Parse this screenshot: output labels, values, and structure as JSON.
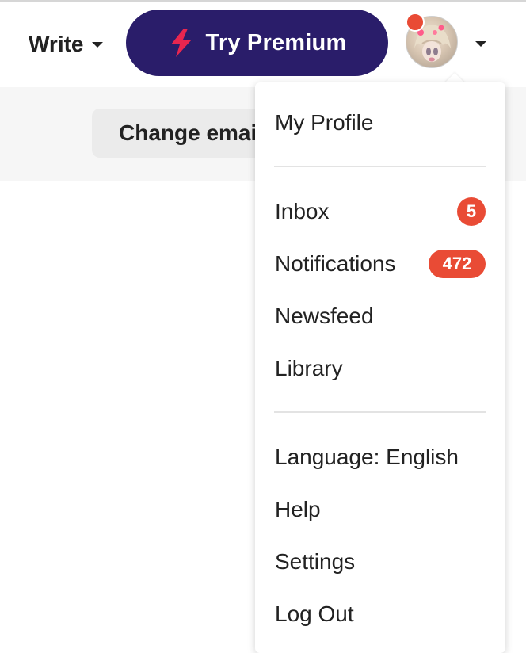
{
  "header": {
    "write_label": "Write",
    "premium_label": "Try Premium",
    "premium_color": "#2a1d6a",
    "bolt_color": "#e8264f",
    "notification_dot_color": "#e94b35"
  },
  "subbar": {
    "change_email_label": "Change email"
  },
  "dropdown": {
    "profile": "My Profile",
    "inbox": {
      "label": "Inbox",
      "count": "5"
    },
    "notifications": {
      "label": "Notifications",
      "count": "472"
    },
    "newsfeed": "Newsfeed",
    "library": "Library",
    "language": "Language: English",
    "help": "Help",
    "settings": "Settings",
    "logout": "Log Out"
  }
}
